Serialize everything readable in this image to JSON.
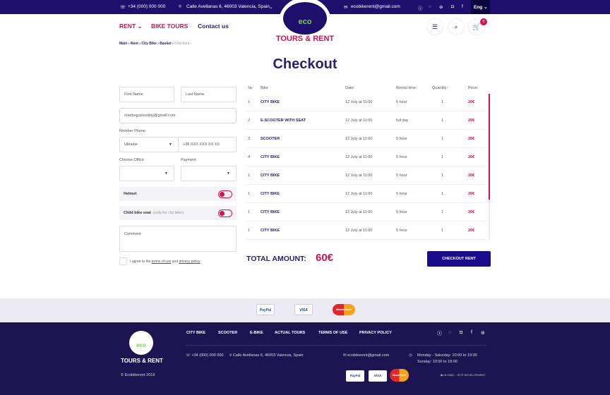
{
  "topbar": {
    "phone": "+34 (000) 000 000",
    "address": "Calle Avellanas 6, 46003 Valencia, Spain",
    "email": "ecobikerent@gmail.com",
    "language": "Eng",
    "social": [
      "skype-icon",
      "whatsapp-icon",
      "tripadvisor-icon",
      "instagram-icon",
      "facebook-icon"
    ]
  },
  "brand": {
    "logo_text": "eco",
    "name": "TOURS & RENT"
  },
  "nav": {
    "rent": "RENT",
    "bike_tours": "BIKE TOURS",
    "contact": "Contact us",
    "cart_count": "0"
  },
  "breadcrumb": [
    "Main",
    "Rent",
    "City Bike",
    "Basket",
    "Checkout"
  ],
  "title": "Checkout",
  "form": {
    "first_name": "First Name",
    "last_name": "Last Name",
    "email": "msebogoslovskiy@gmail.com",
    "phone_label": "Nomber Phone",
    "country": "Ukraine",
    "phone_placeholder": "+38 XXX XXX XX XX",
    "office_label": "Choose Office",
    "payment_label": "Payment",
    "helmet": "Helmet",
    "child_seat": "Child bike seat",
    "child_seat_note": "(only for city bike)",
    "comment": "Comment",
    "agree_prefix": "I agree to the",
    "terms": "terms of use",
    "and": "and",
    "privacy": "privacy policy"
  },
  "table": {
    "headers": [
      "№",
      "Bike",
      "Date:",
      "Rental time:",
      "Quantity:",
      "Price:"
    ],
    "rows": [
      [
        "1",
        "CITY BIKE",
        "12 July at 11:00",
        "5 hour",
        "1",
        "20€"
      ],
      [
        "2",
        "E-SCOOTER WITH SEAT",
        "12 July at 11:00",
        "full day",
        "1",
        "20€"
      ],
      [
        "3",
        "SCOOTER",
        "12 July at 11:00",
        "5 hour",
        "1",
        "20€"
      ],
      [
        "4",
        "CITY BIKE",
        "12 July at 11:00",
        "5 hour",
        "1",
        "20€"
      ],
      [
        "1",
        "CITY BIKE",
        "12 July at 11:00",
        "5 hour",
        "1",
        "20€"
      ],
      [
        "1",
        "CITY BIKE",
        "12 July at 11:00",
        "5 hour",
        "1",
        "20€"
      ],
      [
        "1",
        "CITY BIKE",
        "12 July at 11:00",
        "5 hour",
        "1",
        "20€"
      ],
      [
        "1",
        "CITY BIKE",
        "12 July at 11:00",
        "5 hour",
        "1",
        "20€"
      ]
    ]
  },
  "total": {
    "label": "TOTAL AMOUNT:",
    "value": "60€",
    "button": "CHECKOUT RENT"
  },
  "payments": [
    "PayPal",
    "VISA",
    "MasterCard"
  ],
  "footer": {
    "links": [
      "CITY BIKE",
      "SCOOTER",
      "E-BIKE",
      "ACTUAL TOURS",
      "TERMS OF USE",
      "PRIVACY POLICY"
    ],
    "phone": "+34 (000) 000 000",
    "address": "Calle Avellanas 6, 46003 Valencia, Spain",
    "email": "ecobikerent@gmail.com",
    "hours1": "Monday - Saturday: 10:00 to 19:00",
    "hours2": "Sunday: 10:00 to 18:00",
    "copyright": "© Ecobikerent 2019",
    "dev": "GLOMIC - SITE DEVELOPMENT"
  },
  "colors": {
    "primary": "#1d0f6b",
    "accent": "#d6104f",
    "button": "#1a0a8c"
  }
}
